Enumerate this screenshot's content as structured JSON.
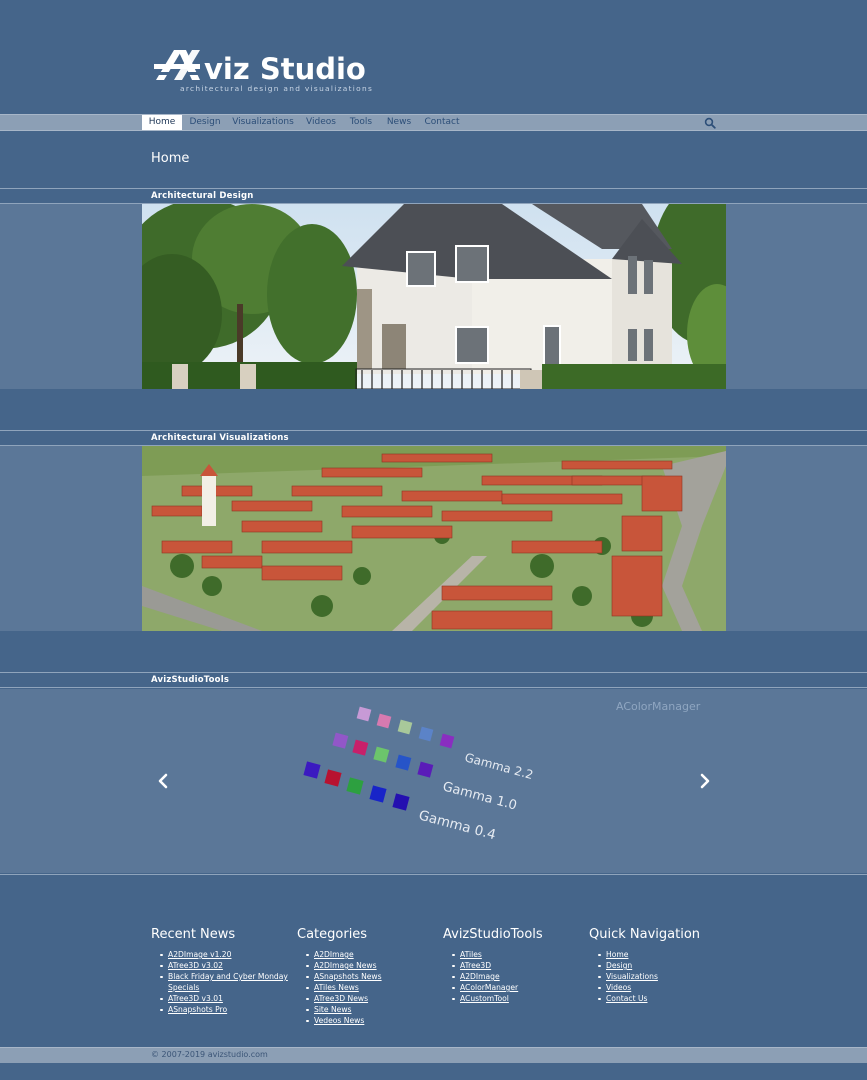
{
  "logo": {
    "name": "viz Studio",
    "tagline": "architectural design and visualizations"
  },
  "nav": {
    "items": [
      {
        "label": "Home",
        "active": true
      },
      {
        "label": "Design"
      },
      {
        "label": "Visualizations"
      },
      {
        "label": "Videos"
      },
      {
        "label": "Tools"
      },
      {
        "label": "News"
      },
      {
        "label": "Contact"
      }
    ],
    "search_icon": "search-icon"
  },
  "page": {
    "title": "Home"
  },
  "sections": {
    "design": {
      "title": "Architectural Design",
      "image": "house-photo"
    },
    "visualizations": {
      "title": "Architectural Visualizations",
      "image": "aerial-village-render"
    },
    "tools": {
      "title": "AvizStudioTools"
    }
  },
  "carousel": {
    "caption": "AColorManager",
    "gamma_labels": [
      "Gamma 2.2",
      "Gamma 1.0",
      "Gamma 0.4"
    ],
    "prev_icon": "chevron-left-icon",
    "next_icon": "chevron-right-icon"
  },
  "footer": {
    "recent_news": {
      "title": "Recent News",
      "items": [
        "A2DImage v1.20",
        "ATree3D v3.02",
        "Black Friday and Cyber Monday Specials",
        "ATree3D v3.01",
        "ASnapshots Pro"
      ]
    },
    "categories": {
      "title": "Categories",
      "items": [
        "A2DImage",
        "A2DImage News",
        "ASnapshots News",
        "ATiles News",
        "ATree3D News",
        "Site News",
        "Vedeos News"
      ]
    },
    "tools": {
      "title": "AvizStudioTools",
      "items": [
        "ATiles",
        "ATree3D",
        "A2DImage",
        "AColorManager",
        "ACustomTool"
      ]
    },
    "quick_nav": {
      "title": "Quick Navigation",
      "items": [
        "Home",
        "Design",
        "Visualizations",
        "Videos",
        "Contact Us"
      ]
    }
  },
  "copyright": "© 2007-2019  avizstudio.com",
  "colors": {
    "background": "#45658a",
    "band": "#5b7798",
    "navbar": "#8c9fb5",
    "link": "#2c4e78"
  }
}
